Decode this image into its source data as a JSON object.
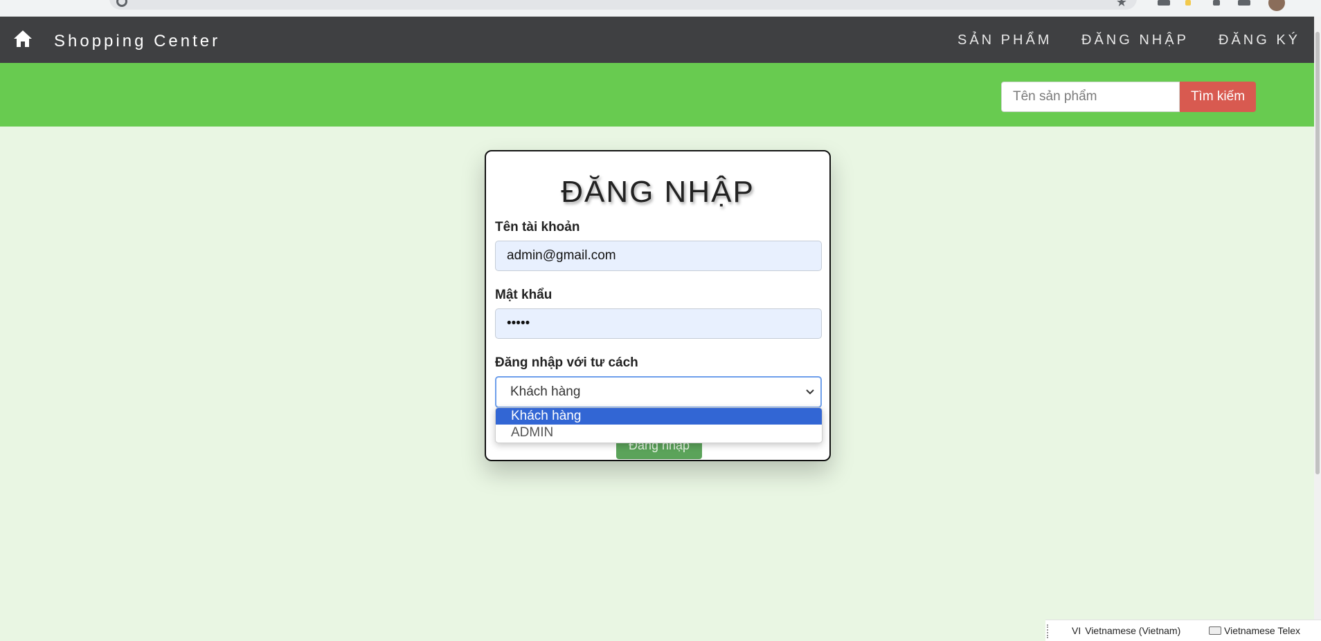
{
  "navbar": {
    "brand": "Shopping Center",
    "items": [
      "SẢN PHẨM",
      "ĐĂNG NHẬP",
      "ĐĂNG KÝ"
    ]
  },
  "search": {
    "placeholder": "Tên sản phẩm",
    "button_label": "Tìm kiếm"
  },
  "login": {
    "title": "ĐĂNG NHẬP",
    "username_label": "Tên tài khoản",
    "username_value": "admin@gmail.com",
    "password_label": "Mật khẩu",
    "password_masked": "•••••",
    "role_label": "Đăng nhập với tư cách",
    "role_selected": "Khách hàng",
    "role_options": [
      "Khách hàng",
      "ADMIN"
    ],
    "submit_label": "Đăng nhập"
  },
  "taskbar": {
    "lang_code": "VI",
    "language": "Vietnamese (Vietnam)",
    "input_method": "Vietnamese Telex"
  },
  "colors": {
    "navbar": "#3f4042",
    "green_bar": "#68cb50",
    "page_bg": "#e9f6e3",
    "search_button": "#d85a50",
    "selected_option": "#3266d4",
    "submit_button": "#5ba35a"
  },
  "icons": [
    "home-icon",
    "chevron-down-icon",
    "keyboard-icon"
  ]
}
